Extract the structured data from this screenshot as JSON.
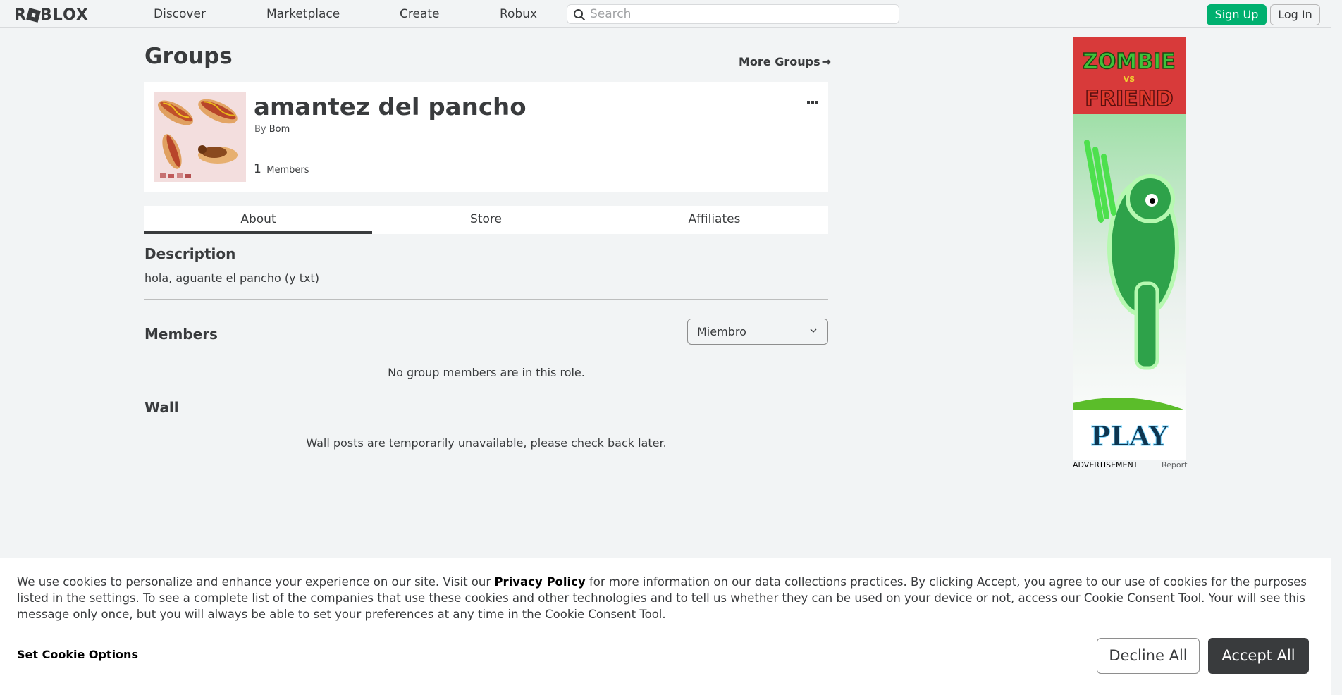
{
  "nav": {
    "logo": "ROBLOX",
    "links": [
      "Discover",
      "Marketplace",
      "Create",
      "Robux"
    ],
    "search_placeholder": "Search",
    "signup_label": "Sign Up",
    "login_label": "Log In"
  },
  "page": {
    "title": "Groups",
    "more_groups": "More Groups"
  },
  "group": {
    "name": "amantez del pancho",
    "by_label": "By",
    "owner": "Bom",
    "member_count": "1",
    "member_label": "Members"
  },
  "tabs": [
    "About",
    "Store",
    "Affiliates"
  ],
  "about": {
    "description_heading": "Description",
    "description": "hola, aguante el pancho (y txt)",
    "members_heading": "Members",
    "role_selected": "Miembro",
    "no_members": "No group members are in this role.",
    "wall_heading": "Wall",
    "wall_message": "Wall posts are temporarily unavailable, please check back later."
  },
  "ad": {
    "title_line1": "ZOMBIE",
    "title_vs": "VS",
    "title_line2": "FRIEND",
    "cta": "PLAY",
    "label": "ADVERTISEMENT",
    "report": "Report"
  },
  "cookie": {
    "text_before": "We use cookies to personalize and enhance your experience on our site. Visit our ",
    "privacy_link": "Privacy Policy",
    "text_after": " for more information on our data collections practices. By clicking Accept, you agree to our use of cookies for the purposes listed in the settings. To see a complete list of the companies that use these cookies and other technologies and to tell us whether they can be used on your device or not, access our Cookie Consent Tool. Your will see this message only once, but you will always be able to set your preferences at any time in the Cookie Consent Tool.",
    "set_options": "Set Cookie Options",
    "decline": "Decline All",
    "accept": "Accept All"
  },
  "colors": {
    "signup_green": "#00b06f",
    "text_dark": "#393b3d",
    "background": "#f2f4f5"
  }
}
